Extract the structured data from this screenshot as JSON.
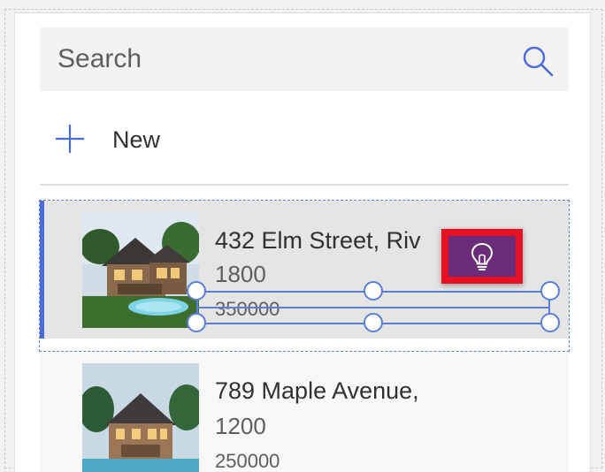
{
  "search": {
    "placeholder": "Search",
    "icon": "search-icon"
  },
  "toolbar": {
    "new_label": "New",
    "new_icon": "plus-icon"
  },
  "gallery": {
    "items": [
      {
        "title": "432 Elm Street, Riv",
        "subtitle": "1800",
        "price": "350000",
        "selected": true
      },
      {
        "title": "789 Maple Avenue,",
        "subtitle": "1200",
        "price": "250000",
        "selected": false
      }
    ]
  },
  "hint_button": {
    "icon": "lightbulb-icon"
  },
  "colors": {
    "accent": "#4a6bd8",
    "selection": "#5b7fd6",
    "hint_bg": "#6b2c7a",
    "highlight": "#e81123"
  }
}
